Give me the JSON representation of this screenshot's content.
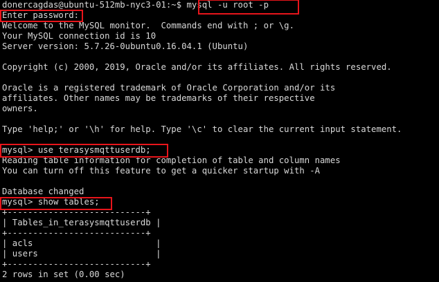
{
  "terminal": {
    "lines": [
      "donercagdas@ubuntu-512mb-nyc3-01:~$ mysql -u root -p",
      "Enter password:",
      "Welcome to the MySQL monitor.  Commands end with ; or \\g.",
      "Your MySQL connection id is 10",
      "Server version: 5.7.26-0ubuntu0.16.04.1 (Ubuntu)",
      "",
      "Copyright (c) 2000, 2019, Oracle and/or its affiliates. All rights reserved.",
      "",
      "Oracle is a registered trademark of Oracle Corporation and/or its",
      "affiliates. Other names may be trademarks of their respective",
      "owners.",
      "",
      "Type 'help;' or '\\h' for help. Type '\\c' to clear the current input statement.",
      "",
      "mysql> use terasysmqttuserdb;",
      "Reading table information for completion of table and column names",
      "You can turn off this feature to get a quicker startup with -A",
      "",
      "Database changed",
      "mysql> show tables;",
      "+---------------------------+",
      "| Tables_in_terasysmqttuserdb |",
      "+---------------------------+",
      "| acls                        |",
      "| users                       |",
      "+---------------------------+",
      "2 rows in set (0.00 sec)"
    ]
  },
  "colors": {
    "background": "#000000",
    "text": "#d9d9d9",
    "highlight": "#e8151b"
  }
}
